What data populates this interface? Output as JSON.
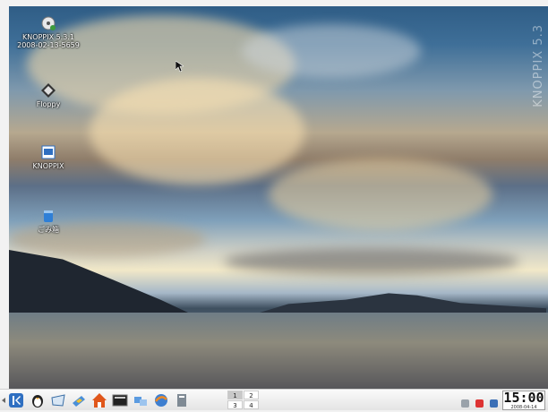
{
  "watermark": "KNOPPIX 5.3",
  "desktop_icons": [
    {
      "id": "cdrom",
      "label": "KNOPPIX 5.3.1\n2008-02-13-5659",
      "icon": "cd-drive-icon"
    },
    {
      "id": "floppy",
      "label": "Floppy",
      "icon": "floppy-icon"
    },
    {
      "id": "knoppix",
      "label": "KNOPPIX",
      "icon": "knoppix-home-icon"
    },
    {
      "id": "trash",
      "label": "ごみ箱",
      "icon": "trash-icon"
    }
  ],
  "taskbar": {
    "launchers": [
      "kde-menu-icon",
      "penguin-icon",
      "konqueror-icon",
      "office-icon",
      "home-folder-icon",
      "terminal-icon",
      "network-icon",
      "browser-icon",
      "text-editor-icon"
    ],
    "pager": [
      "1",
      "2",
      "3",
      "4"
    ],
    "clock_time": "15:00",
    "clock_date": "2008-04-14"
  },
  "colors": {
    "taskbar_bg": "#efefef",
    "kde_blue": "#2f6fc1"
  }
}
